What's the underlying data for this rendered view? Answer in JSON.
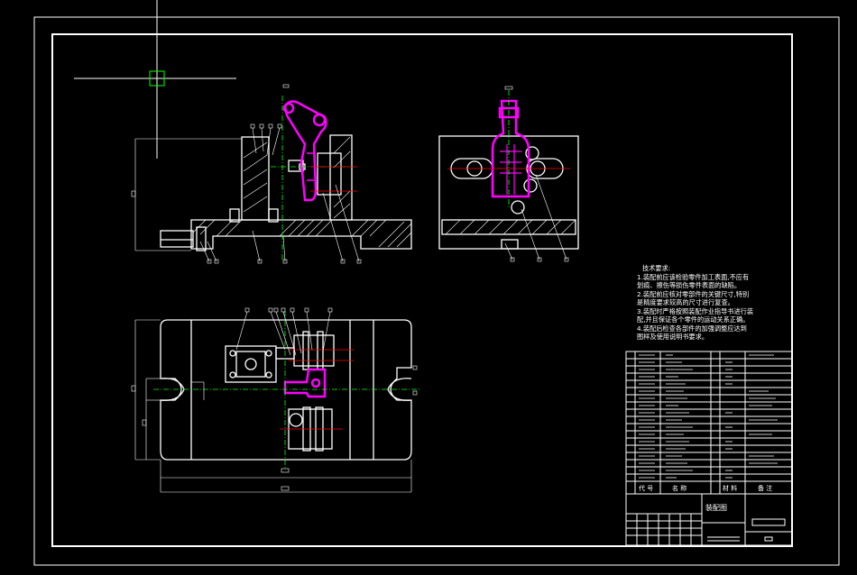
{
  "colors": {
    "background": "#000000",
    "line": "#ffffff",
    "part_highlight": "#ff00ff",
    "center_line": "#00ff00",
    "cut_line": "#ff0000",
    "cursor": "#00ff00"
  },
  "tech_requirements": {
    "title": "技术要求:",
    "lines": [
      "1.装配前应该检验零件加工表面,不应有",
      "划痕、擦伤等损伤零件表面的缺陷。",
      "2.装配前应核对零部件的关键尺寸,特别",
      "是精度要求较高的尺寸进行复查。",
      "3.装配时严格按照装配作业指导书进行装",
      "配,并且保证各个零件的运动关系正确。",
      "4.装配后检查各部件的加强调整应达到",
      "图样及使用说明书要求。"
    ]
  },
  "parts_list_header": {
    "code": "代 号",
    "name": "名 称",
    "material": "材 料",
    "remarks": "备 注"
  },
  "drawing_title": "装配图"
}
